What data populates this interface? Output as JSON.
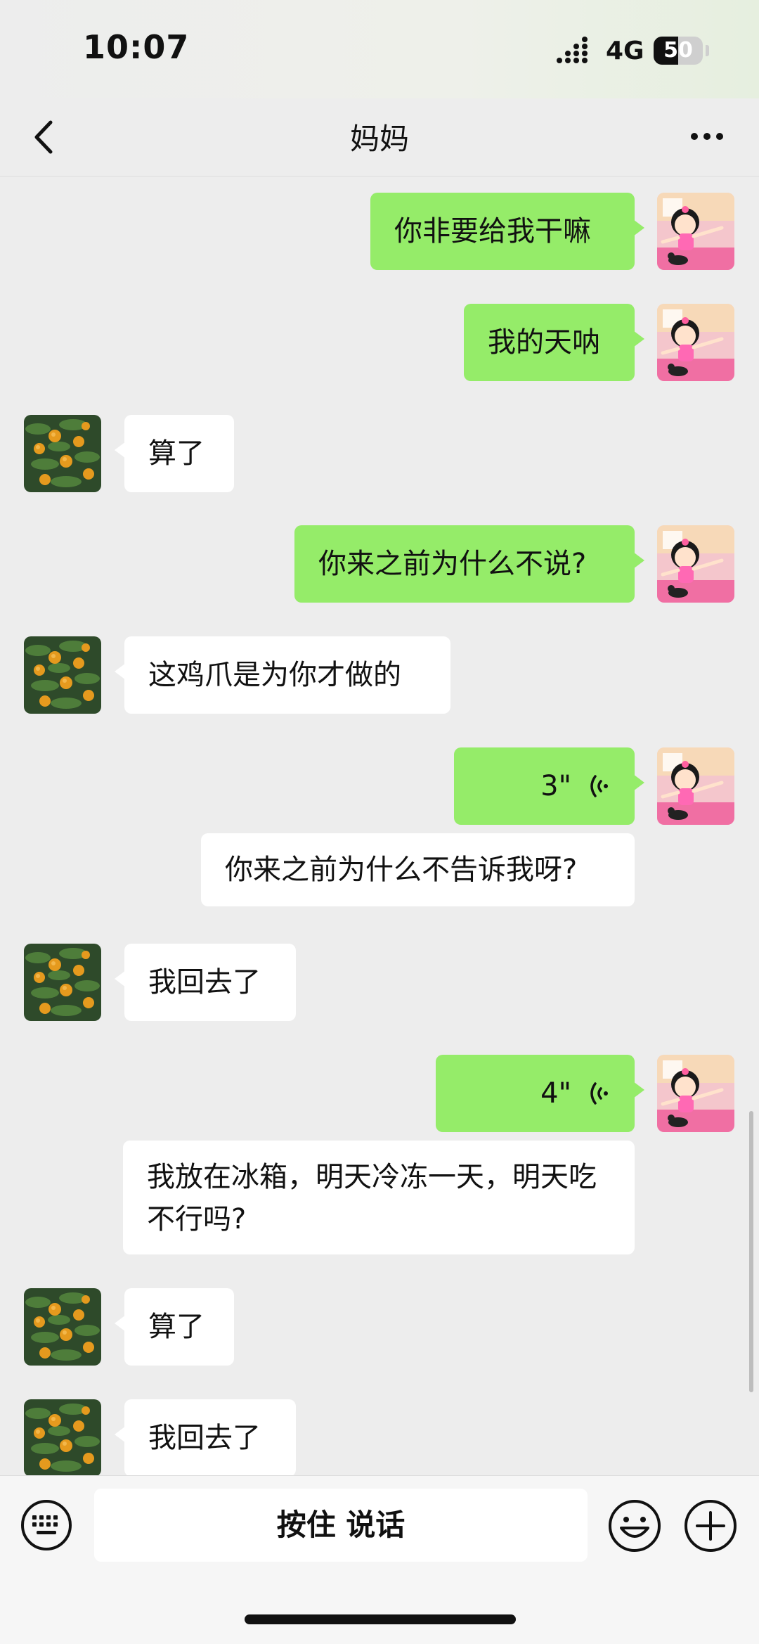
{
  "status_bar": {
    "time": "10:07",
    "network": "4G",
    "battery": "50"
  },
  "nav": {
    "title": "妈妈",
    "back_icon": "chevron-left-icon",
    "more_icon": "more-dots-icon"
  },
  "messages": [
    {
      "from": "me",
      "type": "text",
      "text": "你非要给我干嘛"
    },
    {
      "from": "me",
      "type": "text",
      "text": "我的天呐"
    },
    {
      "from": "mom",
      "type": "text",
      "text": "算了"
    },
    {
      "from": "me",
      "type": "text",
      "text": "你来之前为什么不说?"
    },
    {
      "from": "mom",
      "type": "text",
      "text": "这鸡爪是为你才做的"
    },
    {
      "from": "me",
      "type": "voice",
      "duration": "3\""
    },
    {
      "from": "me",
      "type": "transcript",
      "text": "你来之前为什么不告诉我呀?"
    },
    {
      "from": "mom",
      "type": "text",
      "text": "我回去了"
    },
    {
      "from": "me",
      "type": "voice",
      "duration": "4\""
    },
    {
      "from": "me",
      "type": "transcript",
      "text": "我放在冰箱，明天冷冻一天，明天吃不行吗?"
    },
    {
      "from": "mom",
      "type": "text",
      "text": "算了"
    },
    {
      "from": "mom",
      "type": "text",
      "text": "我回去了"
    }
  ],
  "input_bar": {
    "hold_to_talk": "按住 说话",
    "keyboard_icon": "keyboard-icon",
    "emoji_icon": "emoji-icon",
    "plus_icon": "plus-icon"
  },
  "colors": {
    "outgoing_bubble": "#95ec69",
    "incoming_bubble": "#ffffff",
    "background": "#ededed"
  }
}
